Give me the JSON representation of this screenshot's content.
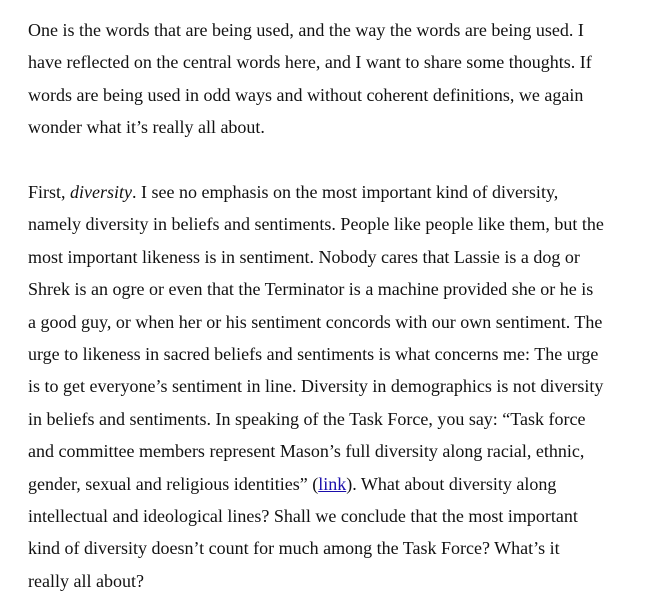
{
  "paragraph1": {
    "lines": [
      "One is the words that are being used, and the way the words are being used. I",
      "have reflected on the central words here, and I want to share some thoughts. If",
      "words are being used in odd ways and without coherent definitions, we again",
      "wonder what it’s really all about."
    ]
  },
  "paragraph2": {
    "first_line_prefix": "First, ",
    "emphasis_word": "diversity",
    "first_line_suffix": ". I see no emphasis on the most important kind of diversity,",
    "lines": [
      "namely diversity in beliefs and sentiments. People like people like them, but the",
      "most important likeness is in sentiment. Nobody cares that Lassie is a dog or",
      "Shrek is an ogre or even that the Terminator is a machine provided she or he is",
      "a good guy, or when her or his sentiment concords with our own sentiment. The",
      "urge to likeness in sacred beliefs and sentiments is what concerns me: The urge",
      "is to get everyone’s sentiment in line. Diversity in demographics is not diversity",
      "in beliefs and sentiments. In speaking of the Task Force, you say: “Task force",
      "and committee members represent Mason’s full diversity along racial, ethnic,"
    ],
    "link_line_prefix": "gender, sexual and religious identities” (",
    "link_text": "link",
    "link_line_suffix": "). What about diversity along",
    "tail_lines": [
      "intellectual and ideological lines? Shall we conclude that the most important",
      "kind of diversity doesn’t count for much among the Task Force? What’s it",
      "really all about?"
    ]
  }
}
